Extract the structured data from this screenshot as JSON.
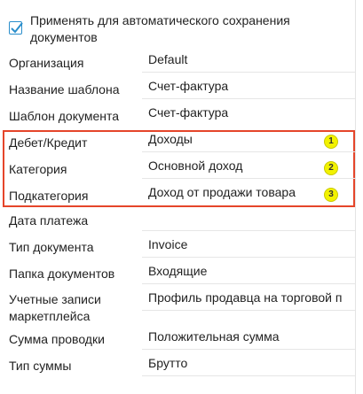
{
  "checkbox": {
    "checked": true,
    "label_line1": "Применять для автоматического сохранения",
    "label_line2": "документов"
  },
  "fields": [
    {
      "label": "Организация",
      "value": "Default"
    },
    {
      "label": "Название шаблона",
      "value": "Счет-фактура"
    },
    {
      "label": "Шаблон документа",
      "value": "Счет-фактура"
    },
    {
      "label": "Дебет/Кредит",
      "value": "Доходы",
      "badge": "1"
    },
    {
      "label": "Категория",
      "value": "Основной доход",
      "badge": "2"
    },
    {
      "label": "Подкатегория",
      "value": "Доход от продажи товара",
      "badge": "3"
    },
    {
      "label": "Дата платежа",
      "value": ""
    },
    {
      "label": "Тип документа",
      "value": "Invoice"
    },
    {
      "label": "Папка документов",
      "value": "Входящие"
    },
    {
      "label_line1": "Учетные записи",
      "label_line2": "маркетплейса",
      "value": "Профиль продавца на торговой п"
    },
    {
      "label": "Сумма проводки",
      "value": "Положительная сумма"
    },
    {
      "label": "Тип суммы",
      "value": "Брутто"
    }
  ],
  "colors": {
    "accent": "#2a8ecb",
    "highlight_border": "#e5452a",
    "badge_fill": "#f2f200"
  }
}
